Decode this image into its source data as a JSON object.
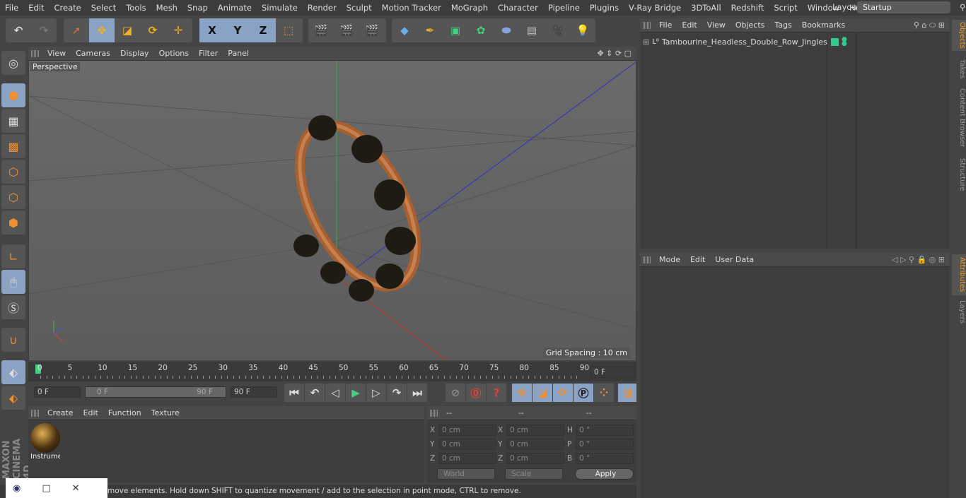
{
  "menubar": {
    "items": [
      "File",
      "Edit",
      "Create",
      "Select",
      "Tools",
      "Mesh",
      "Snap",
      "Animate",
      "Simulate",
      "Render",
      "Sculpt",
      "Motion Tracker",
      "MoGraph",
      "Character",
      "Pipeline",
      "Plugins",
      "V-Ray Bridge",
      "3DToAll",
      "Redshift",
      "Script",
      "Window",
      "Help"
    ],
    "layout_label": "Layout:",
    "layout_value": "Startup"
  },
  "toolbar": {
    "axis": [
      "X",
      "Y",
      "Z"
    ]
  },
  "viewport": {
    "menu": [
      "View",
      "Cameras",
      "Display",
      "Options",
      "Filter",
      "Panel"
    ],
    "camera_label": "Perspective",
    "grid_spacing": "Grid Spacing : 10 cm",
    "colors": {
      "x_axis": "#c03030",
      "y_axis": "#30b030",
      "z_axis": "#3030c0",
      "wood": "#b87040"
    }
  },
  "timeline": {
    "ticks": [
      "0",
      "5",
      "10",
      "15",
      "20",
      "25",
      "30",
      "35",
      "40",
      "45",
      "50",
      "55",
      "60",
      "65",
      "70",
      "75",
      "80",
      "85",
      "90"
    ],
    "current_frame": "0 F",
    "start": "0 F",
    "range_start": "0 F",
    "range_end": "90 F",
    "end": "90 F"
  },
  "material": {
    "menu": [
      "Create",
      "Edit",
      "Function",
      "Texture"
    ],
    "items": [
      {
        "name": "Instrume"
      }
    ]
  },
  "coords": {
    "headers": [
      "--",
      "--",
      "--"
    ],
    "rows": [
      {
        "l1": "X",
        "v1": "0 cm",
        "l2": "X",
        "v2": "0 cm",
        "l3": "H",
        "v3": "0 °"
      },
      {
        "l1": "Y",
        "v1": "0 cm",
        "l2": "Y",
        "v2": "0 cm",
        "l3": "P",
        "v3": "0 °"
      },
      {
        "l1": "Z",
        "v1": "0 cm",
        "l2": "Z",
        "v2": "0 cm",
        "l3": "B",
        "v3": "0 °"
      }
    ],
    "space": "World",
    "mode": "Scale",
    "apply": "Apply"
  },
  "status": "move elements. Hold down SHIFT to quantize movement / add to the selection in point mode, CTRL to remove.",
  "objects": {
    "menu": [
      "File",
      "Edit",
      "View",
      "Objects",
      "Tags",
      "Bookmarks"
    ],
    "items": [
      {
        "name": "Tambourine_Headless_Double_Row_Jingles",
        "tag_color": "#2ecc8a"
      }
    ]
  },
  "attributes": {
    "menu": [
      "Mode",
      "Edit",
      "User Data"
    ]
  },
  "side_tabs": [
    "Objects",
    "Takes",
    "Content Browser",
    "Structure",
    "Attributes",
    "Layers"
  ],
  "brand": "MAXON CINEMA 4D"
}
